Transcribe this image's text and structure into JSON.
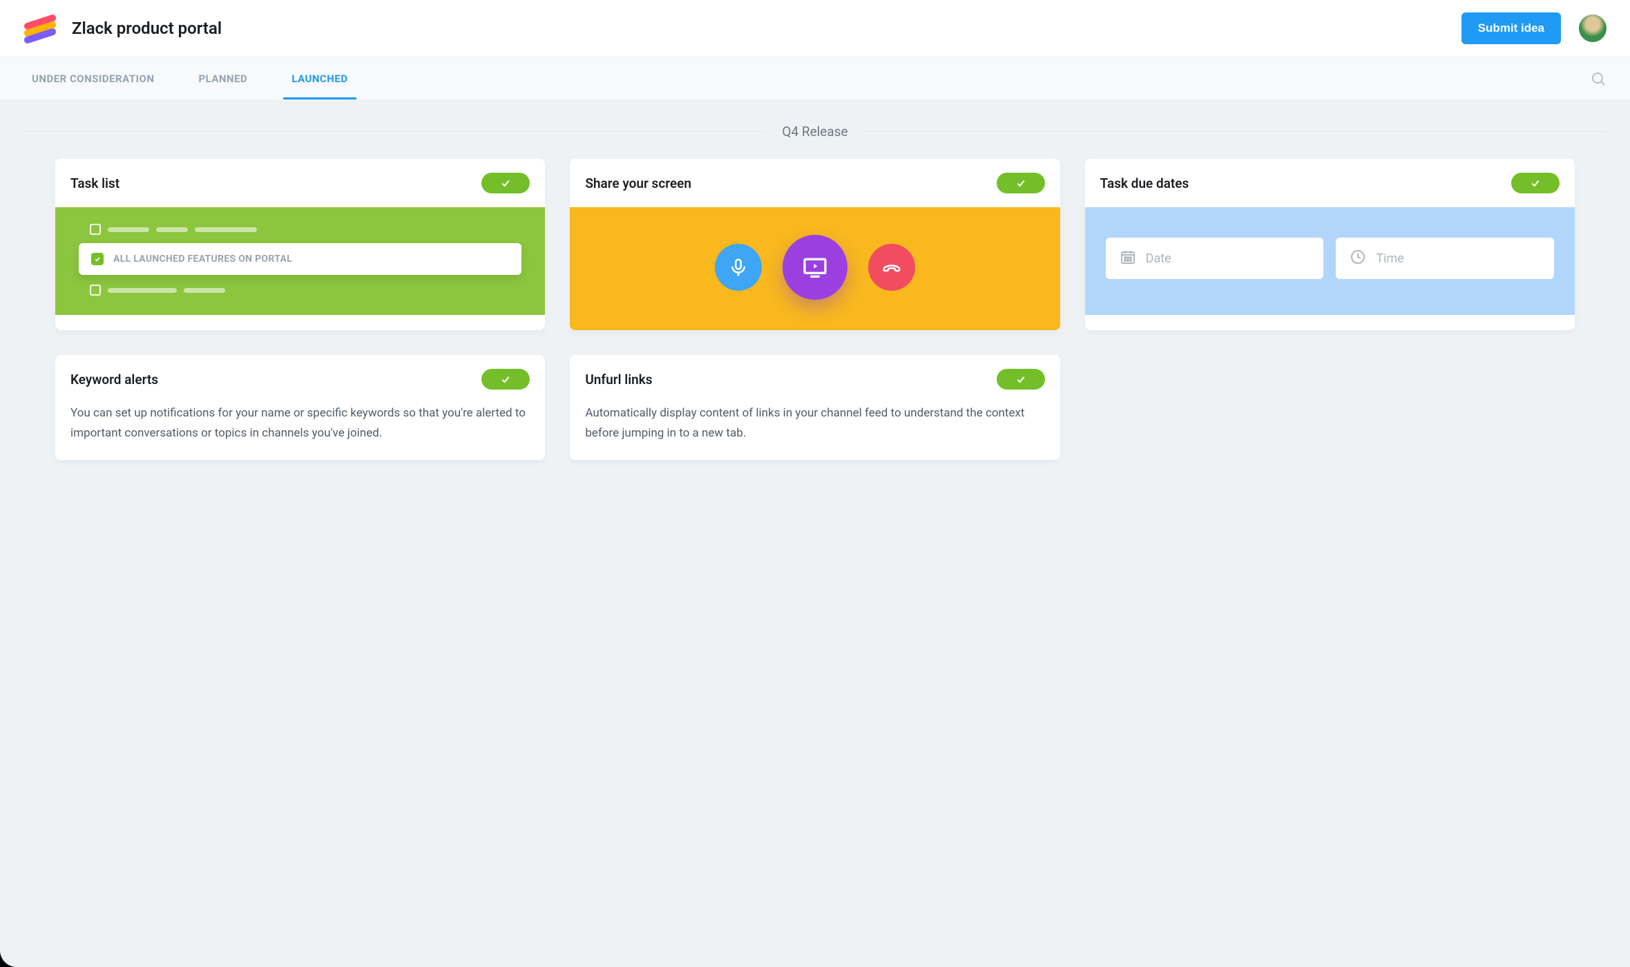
{
  "header": {
    "title": "Zlack product portal",
    "submit_label": "Submit idea"
  },
  "tabs": [
    {
      "label": "UNDER CONSIDERATION",
      "active": false
    },
    {
      "label": "PLANNED",
      "active": false
    },
    {
      "label": "LAUNCHED",
      "active": true
    }
  ],
  "section_title": "Q4 Release",
  "cards": {
    "task_list": {
      "title": "Task list",
      "callout": "ALL LAUNCHED FEATURES ON PORTAL"
    },
    "share_screen": {
      "title": "Share your screen"
    },
    "due_dates": {
      "title": "Task due dates",
      "date_placeholder": "Date",
      "time_placeholder": "Time"
    },
    "keyword_alerts": {
      "title": "Keyword alerts",
      "body": "You can set up notifications for your name or specific keywords so that you're alerted to important conversations or topics in channels you've joined."
    },
    "unfurl_links": {
      "title": "Unfurl links",
      "body": "Automatically display content of links in your channel feed to understand the context before jumping in to a new tab."
    }
  },
  "colors": {
    "primary": "#1f9af5",
    "success": "#74bf29",
    "tasklist_bg": "#8cc63e",
    "screenshare_bg": "#f8b81e",
    "duedates_bg": "#b2d6fb",
    "accent_blue": "#3ea6f4",
    "accent_purple": "#9b3fe0",
    "accent_red": "#f14c60"
  }
}
